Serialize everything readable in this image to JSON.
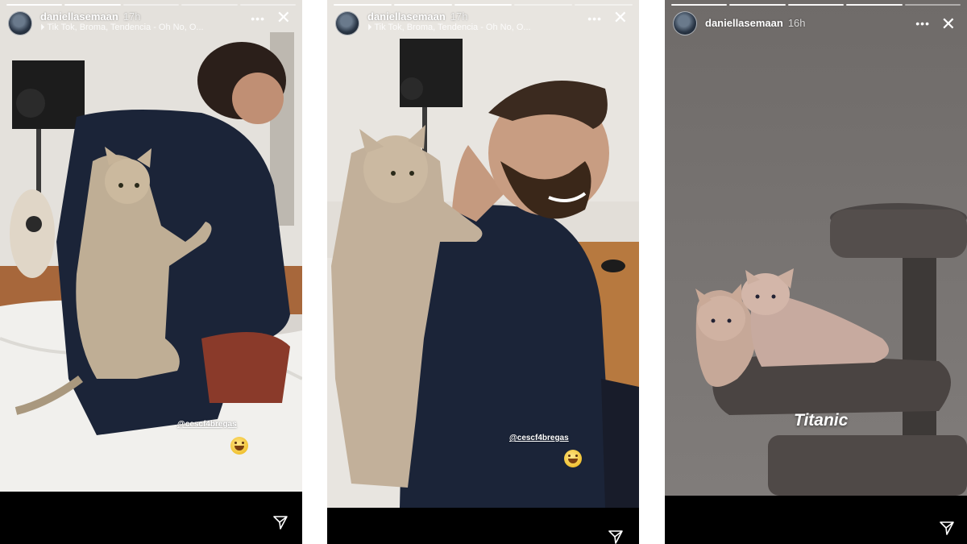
{
  "stories": [
    {
      "username": "daniellasemaan",
      "time": "17h",
      "music": "⏵ Tik Tok, Broma, Tendencia - Oh No, O...",
      "mention": "@cescf4bregas",
      "emoji_icon": "grinning-sweat-emoji",
      "more": "•••",
      "close": "✕"
    },
    {
      "username": "daniellasemaan",
      "time": "17h",
      "music": "⏵ Tik Tok, Broma, Tendencia - Oh No, O...",
      "mention": "@cescf4bregas",
      "emoji_icon": "grinning-sweat-emoji",
      "more": "•••",
      "close": "✕"
    },
    {
      "username": "daniellasemaan",
      "time": "16h",
      "caption": "Titanic",
      "more": "•••",
      "close": "✕"
    }
  ]
}
